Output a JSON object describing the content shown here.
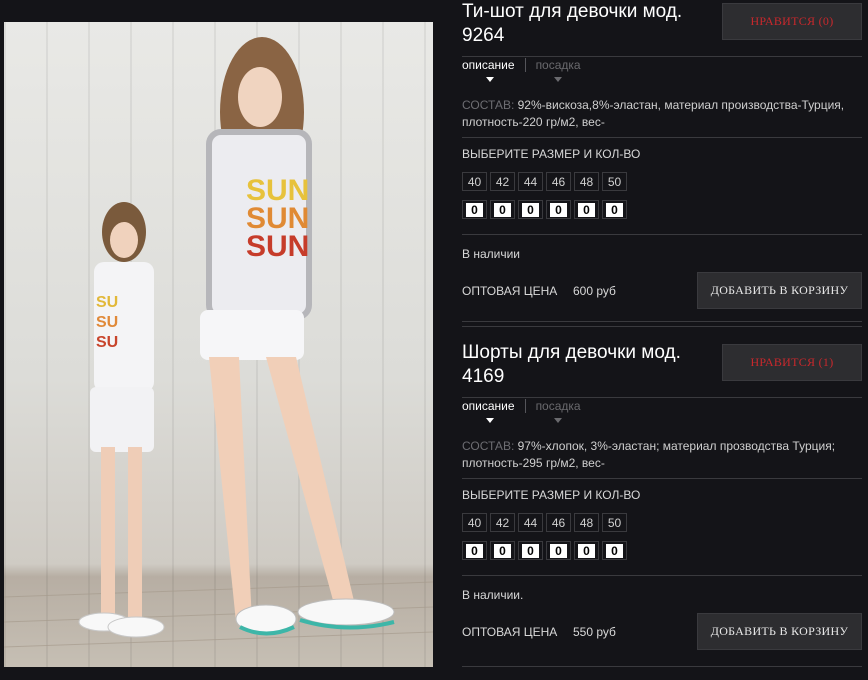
{
  "products": [
    {
      "title": "Ти-шот для девочки мод. 9264",
      "like_label": "НРАВИТСЯ (0)",
      "tab_description": "описание",
      "tab_fit": "посадка",
      "composition_label": "СОСТАВ:",
      "composition_text": " 92%-вискоза,8%-эластан, материал производства-Турция, плотность-220 гр/м2, вес-",
      "size_heading": "ВЫБЕРИТЕ РАЗМЕР И КОЛ-ВО",
      "sizes": [
        "40",
        "42",
        "44",
        "46",
        "48",
        "50"
      ],
      "quantities": [
        "0",
        "0",
        "0",
        "0",
        "0",
        "0"
      ],
      "availability": "В наличии",
      "price_label": "ОПТОВАЯ ЦЕНА",
      "price_value": "600 руб",
      "cart_label": "ДОБАВИТЬ В КОРЗИНУ"
    },
    {
      "title": "Шорты для девочки мод. 4169",
      "like_label": "НРАВИТСЯ (1)",
      "tab_description": "описание",
      "tab_fit": "посадка",
      "composition_label": "СОСТАВ:",
      "composition_text": " 97%-хлопок, 3%-эластан; материал прозводства Турция; плотность-295 гр/м2, вес-",
      "size_heading": "ВЫБЕРИТЕ РАЗМЕР И КОЛ-ВО",
      "sizes": [
        "40",
        "42",
        "44",
        "46",
        "48",
        "50"
      ],
      "quantities": [
        "0",
        "0",
        "0",
        "0",
        "0",
        "0"
      ],
      "availability": "В наличии.",
      "price_label": "ОПТОВАЯ ЦЕНА",
      "price_value": "550 руб",
      "cart_label": "ДОБАВИТЬ В КОРЗИНУ"
    }
  ],
  "photo": {
    "shirt_print": [
      "SUN",
      "SUN",
      "SUN"
    ]
  },
  "colors": {
    "background": "#141418",
    "like_red": "#c8282c",
    "button_bg": "#2d2d30"
  }
}
